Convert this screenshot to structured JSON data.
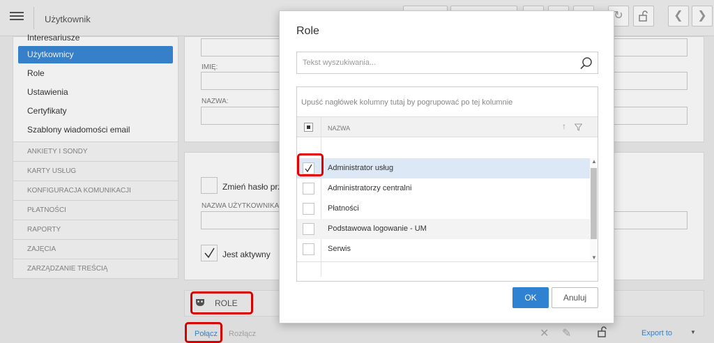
{
  "header": {
    "title": "Użytkownik",
    "icons": [
      "menu-icon",
      "refresh-icon",
      "unlock-icon",
      "chevron-left-icon",
      "chevron-right-icon"
    ]
  },
  "sidebar": {
    "cut_item": "Interesariusze",
    "items": [
      {
        "label": "Użytkownicy",
        "active": true
      },
      {
        "label": "Role"
      },
      {
        "label": "Ustawienia"
      },
      {
        "label": "Certyfikaty"
      },
      {
        "label": "Szablony wiadomości email"
      }
    ],
    "sections": [
      "ANKIETY I SONDY",
      "KARTY USŁUG",
      "KONFIGURACJA KOMUNIKACJI",
      "PŁATNOŚCI",
      "RAPORTY",
      "ZAJĘCIA",
      "ZARZĄDZANIE TREŚCIĄ"
    ]
  },
  "form": {
    "imie_label": "IMIĘ:",
    "nazwa_label": "NAZWA:",
    "change_password_label": "Zmień hasło przy",
    "username_label": "NAZWA UŻYTKOWNIKA:*",
    "active_label": "Jest aktywny",
    "active_checked": true
  },
  "roles_section": {
    "title": "ROLE",
    "connect": "Połącz",
    "disconnect": "Rozłącz",
    "export": "Export to"
  },
  "modal": {
    "title": "Role",
    "search_placeholder": "Tekst wyszukiwania...",
    "group_hint": "Upuść nagłówek kolumny tutaj by pogrupować po tej kolumnie",
    "column": "NAZWA",
    "rows": [
      {
        "name": "Administrator usług",
        "checked": true
      },
      {
        "name": "Administratorzy centralni",
        "checked": false
      },
      {
        "name": "Płatności",
        "checked": false
      },
      {
        "name": "Podstawowa logowanie - UM",
        "checked": false
      },
      {
        "name": "Serwis",
        "checked": false
      }
    ],
    "ok": "OK",
    "cancel": "Anuluj"
  },
  "colors": {
    "accent": "#3a87d6",
    "highlight": "#e30000",
    "selected_row": "#dce8f5"
  }
}
